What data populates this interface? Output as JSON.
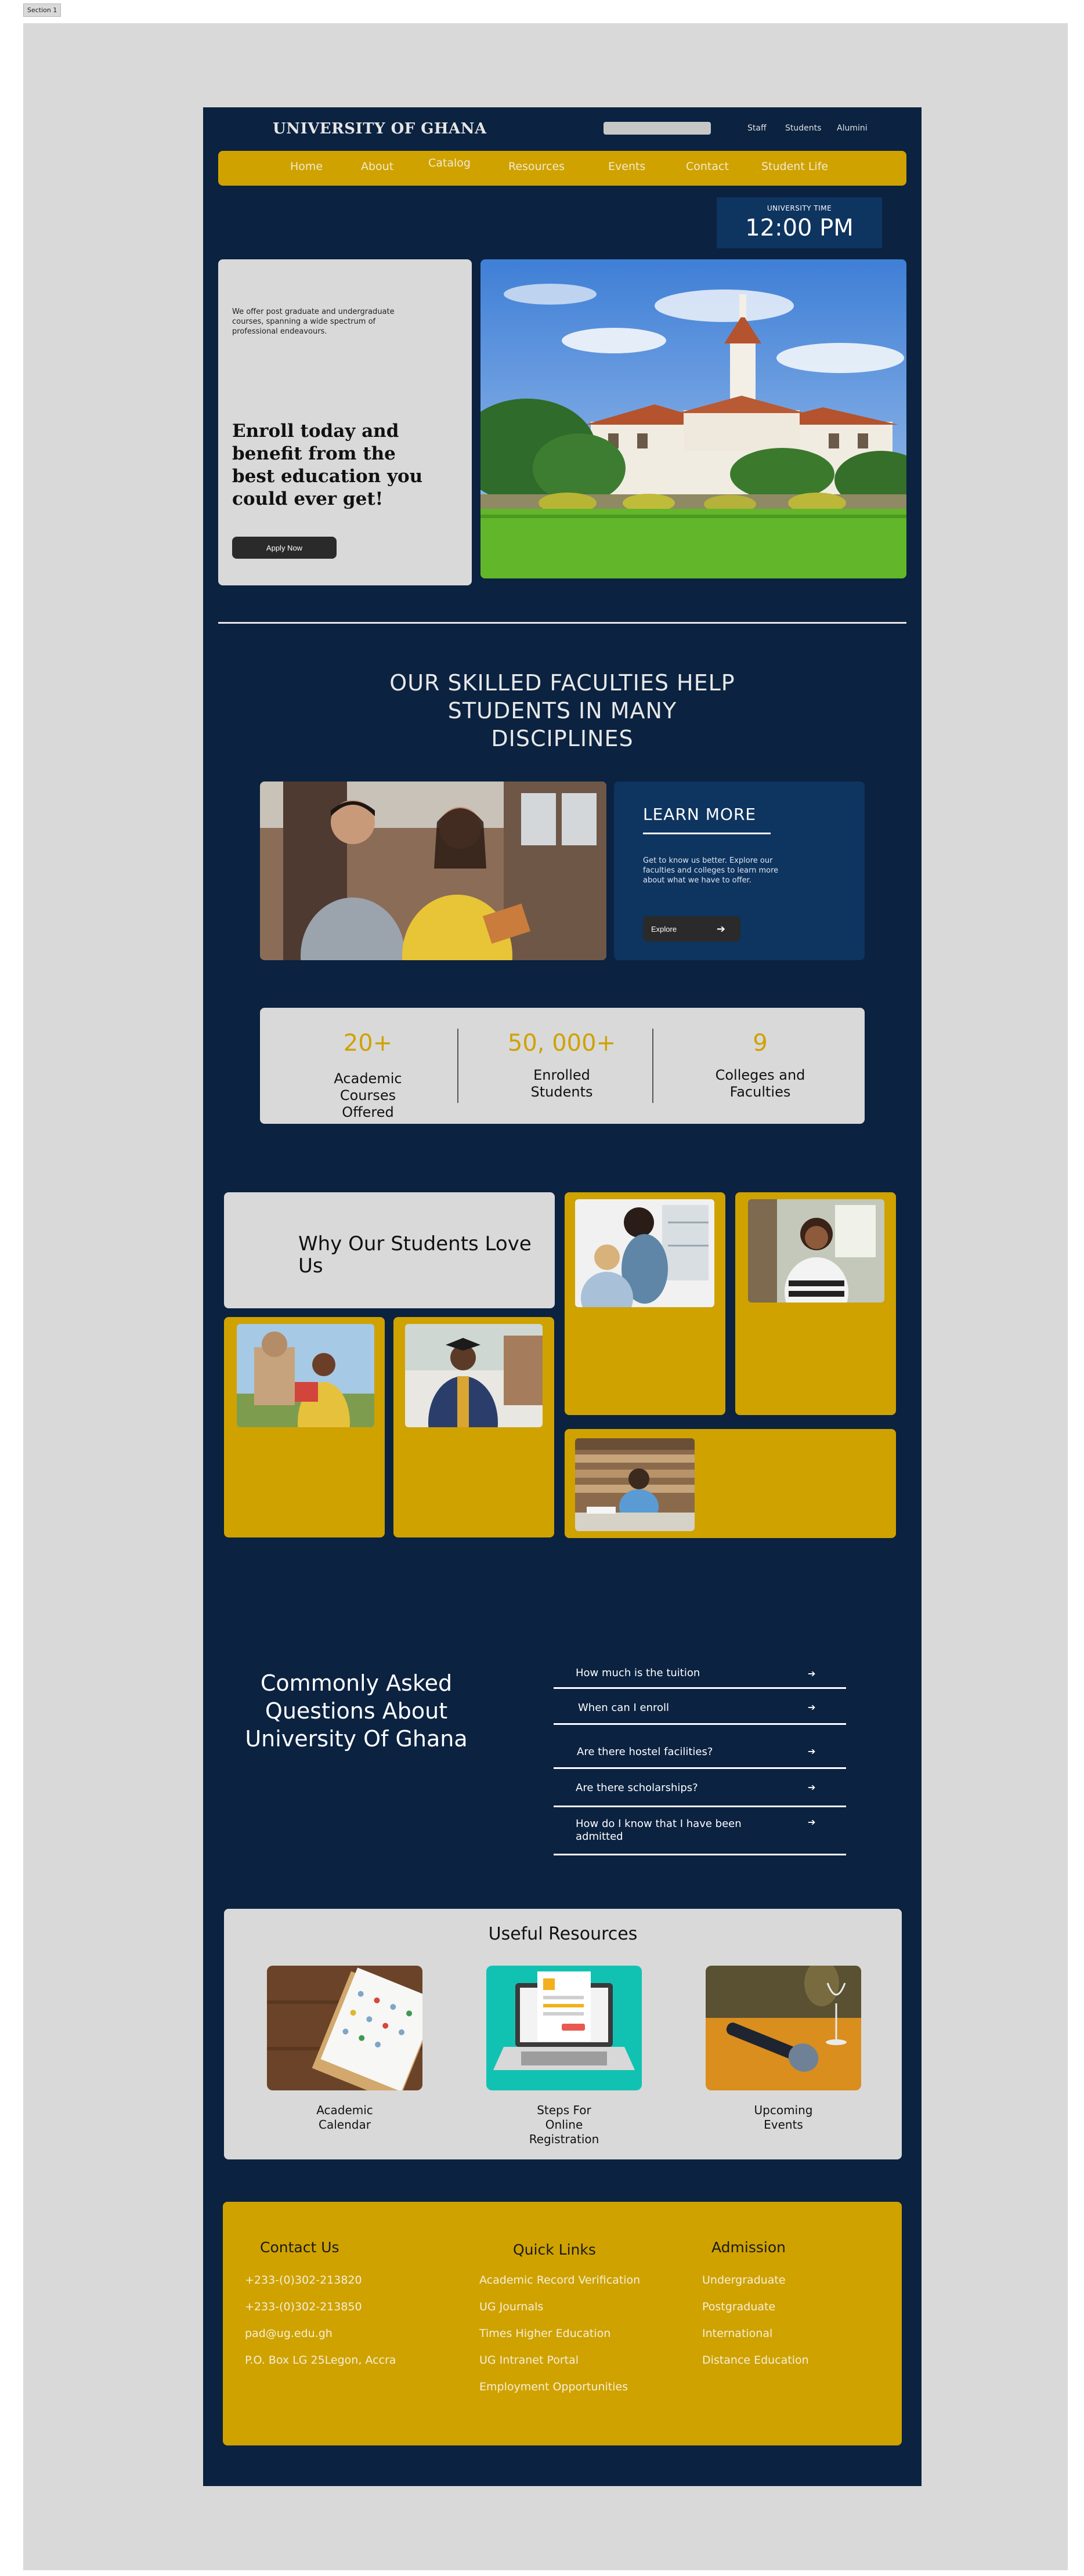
{
  "section_tag": "Section 1",
  "header": {
    "logo": "UNIVERSITY OF GHANA",
    "search_placeholder": "",
    "top_links": [
      "Staff",
      "Students",
      "Alumini"
    ]
  },
  "nav": [
    "Home",
    "About",
    "Catalog",
    "Resources",
    "Events",
    "Contact",
    "Student Life"
  ],
  "clock": {
    "label": "UNIVERSITY TIME",
    "time": "12:00 PM"
  },
  "hero": {
    "blurb": "We offer post graduate and undergraduate courses, spanning a wide spectrum of professional endeavours.",
    "title": "Enroll today and benefit from the best education you could ever get!",
    "button": "Apply Now"
  },
  "faculties": {
    "heading": "OUR SKILLED FACULTIES HELP STUDENTS IN MANY DISCIPLINES",
    "learn_title": "LEARN MORE",
    "learn_text": "Get to know us better. Explore our faculties and colleges to learn more about what we have to offer.",
    "explore_label": "Explore",
    "explore_arrow": "➔"
  },
  "stats": [
    {
      "value": "20+",
      "label": "Academic Courses Offered"
    },
    {
      "value": "50, 000+",
      "label": "Enrolled Students"
    },
    {
      "value": "9",
      "label": "Colleges and Faculties"
    }
  ],
  "gallery": {
    "title": "Why Our Students Love Us"
  },
  "faq": {
    "title": "Commonly Asked Questions About University Of Ghana",
    "arrow": "➔",
    "items": [
      "How much is the tuition",
      "When can I enroll",
      "Are there hostel facilities?",
      "Are there scholarships?",
      "How do I know that I have been admitted"
    ]
  },
  "resources": {
    "title": "Useful Resources",
    "items": [
      "Academic Calendar",
      "Steps For Online Registration",
      "Upcoming Events"
    ]
  },
  "footer": {
    "contact": {
      "title": "Contact Us",
      "lines": [
        "+233-(0)302-213820",
        "+233-(0)302-213850",
        "pad@ug.edu.gh",
        "P.O. Box LG 25Legon, Accra"
      ]
    },
    "quick_links": {
      "title": "Quick Links",
      "lines": [
        "Academic Record Verification",
        "UG Journals",
        "Times Higher Education",
        "UG Intranet Portal",
        "Employment Opportunities"
      ]
    },
    "admission": {
      "title": "Admission",
      "lines": [
        "Undergraduate",
        "Postgraduate",
        "International",
        "Distance Education"
      ]
    }
  },
  "colors": {
    "navy": "#0b2240",
    "gold": "#cfa200",
    "panel_grey": "#d9d9d9",
    "card_blue": "#0e3460"
  }
}
